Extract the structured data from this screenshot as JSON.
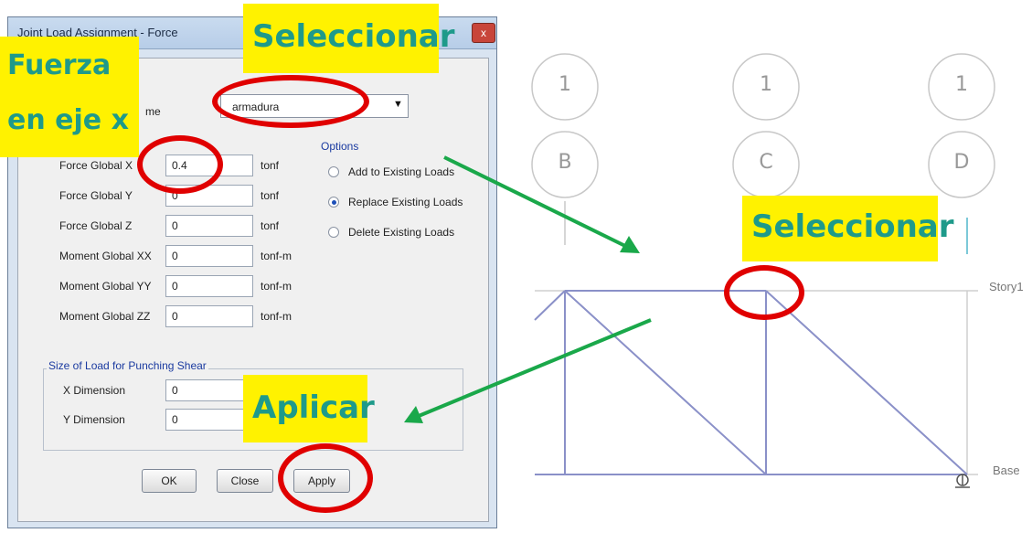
{
  "dialog": {
    "title": "Joint Load Assignment - Force",
    "close_glyph": "x",
    "load_pattern_partial_label": "me",
    "load_pattern_value": "armadura",
    "forces": [
      {
        "label": "Force Global X",
        "value": "0.4",
        "unit": "tonf"
      },
      {
        "label": "Force Global Y",
        "value": "0",
        "unit": "tonf"
      },
      {
        "label": "Force Global Z",
        "value": "0",
        "unit": "tonf"
      },
      {
        "label": "Moment Global XX",
        "value": "0",
        "unit": "tonf-m"
      },
      {
        "label": "Moment Global YY",
        "value": "0",
        "unit": "tonf-m"
      },
      {
        "label": "Moment Global ZZ",
        "value": "0",
        "unit": "tonf-m"
      }
    ],
    "options": {
      "title": "Options",
      "items": [
        {
          "label": "Add to Existing Loads",
          "selected": false
        },
        {
          "label": "Replace Existing Loads",
          "selected": true
        },
        {
          "label": "Delete Existing Loads",
          "selected": false
        }
      ]
    },
    "punching": {
      "title": "Size of Load for Punching Shear",
      "items": [
        {
          "label": "X Dimension",
          "value": "0"
        },
        {
          "label": "Y Dimension",
          "value": "0"
        }
      ]
    },
    "buttons": {
      "ok": "OK",
      "close": "Close",
      "apply": "Apply"
    }
  },
  "callouts": {
    "fuerza_line1": "Fuerza",
    "fuerza_line2": "en eje x",
    "seleccionar_top": "Seleccionar",
    "seleccionar_model": "Seleccionar",
    "aplicar": "Aplicar"
  },
  "model": {
    "grid_bubbles": [
      {
        "top": "1",
        "bottom": "B"
      },
      {
        "top": "1",
        "bottom": "C"
      },
      {
        "top": "1",
        "bottom": "D"
      }
    ],
    "story_labels": {
      "story1": "Story1",
      "base": "Base"
    }
  },
  "colors": {
    "callout_bg": "#fff200",
    "callout_text": "#1e9a8a",
    "highlight_ring": "#e00000",
    "arrow": "#1aa84a",
    "frame_line": "#8a90c8"
  }
}
